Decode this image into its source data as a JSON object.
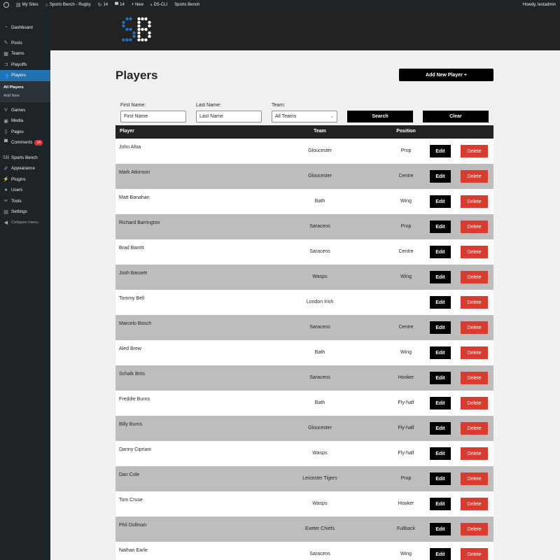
{
  "adminbar": {
    "my_sites": "My Sites",
    "site_name": "Sports Bench - Rugby",
    "updates": "14",
    "comments": "14",
    "new": "+ New",
    "ds_cli": "DS-CLI",
    "sports_bench": "Sports Bench",
    "howdy": "Howdy, testadmin"
  },
  "sidebar": {
    "dashboard": "Dashboard",
    "posts": "Posts",
    "teams": "Teams",
    "playoffs": "Playoffs",
    "players": "Players",
    "all_players": "All Players",
    "add_new": "Add New",
    "games": "Games",
    "media": "Media",
    "pages": "Pages",
    "comments": "Comments",
    "comments_count": "14",
    "sports_bench": "Sports Bench",
    "appearance": "Appearance",
    "plugins": "Plugins",
    "users": "Users",
    "tools": "Tools",
    "settings": "Settings",
    "collapse": "Collapse menu"
  },
  "page": {
    "title": "Players",
    "add_new_label": "Add New Player +"
  },
  "filters": {
    "first_name_label": "First Name:",
    "first_name_placeholder": "First Name",
    "last_name_label": "Last Name:",
    "last_name_placeholder": "Last Name",
    "team_label": "Team:",
    "team_selected": "All Teams",
    "search_label": "Search",
    "clear_label": "Clear"
  },
  "table": {
    "headers": {
      "player": "Player",
      "team": "Team",
      "position": "Position"
    },
    "edit_label": "Edit",
    "delete_label": "Delete",
    "rows": [
      {
        "name": "John Afoa",
        "team": "Gloucester",
        "position": "Prop"
      },
      {
        "name": "Mark Atkinson",
        "team": "Gloucester",
        "position": "Centre"
      },
      {
        "name": "Matt Banahan",
        "team": "Bath",
        "position": "Wing"
      },
      {
        "name": "Richard Barrington",
        "team": "Saracens",
        "position": "Prop"
      },
      {
        "name": "Brad Barritt",
        "team": "Saracens",
        "position": "Centre"
      },
      {
        "name": "Josh Bassett",
        "team": "Wasps",
        "position": "Wing"
      },
      {
        "name": "Tommy Bell",
        "team": "London Irish",
        "position": ""
      },
      {
        "name": "Marcelo Bosch",
        "team": "Saracens",
        "position": "Centre"
      },
      {
        "name": "Aled Brew",
        "team": "Bath",
        "position": "Wing"
      },
      {
        "name": "Schalk Brits",
        "team": "Saracens",
        "position": "Hooker"
      },
      {
        "name": "Freddie Burns",
        "team": "Bath",
        "position": "Fly-half"
      },
      {
        "name": "Billy Burns",
        "team": "Gloucester",
        "position": "Fly-half"
      },
      {
        "name": "Danny Cipriani",
        "team": "Wasps",
        "position": "Fly-half"
      },
      {
        "name": "Dan Cole",
        "team": "Leicester Tigers",
        "position": "Prop"
      },
      {
        "name": "Tom Cruse",
        "team": "Wasps",
        "position": "Hooker"
      },
      {
        "name": "Phil Dollman",
        "team": "Exeter Chiefs",
        "position": "Fullback"
      },
      {
        "name": "Nathan Earle",
        "team": "Saracens",
        "position": "Wing"
      }
    ]
  },
  "colors": {
    "admin_dark": "#1d2327",
    "accent_blue": "#2271b1",
    "delete_red": "#d63c2f",
    "row_alt_gray": "#bdbdbd"
  }
}
